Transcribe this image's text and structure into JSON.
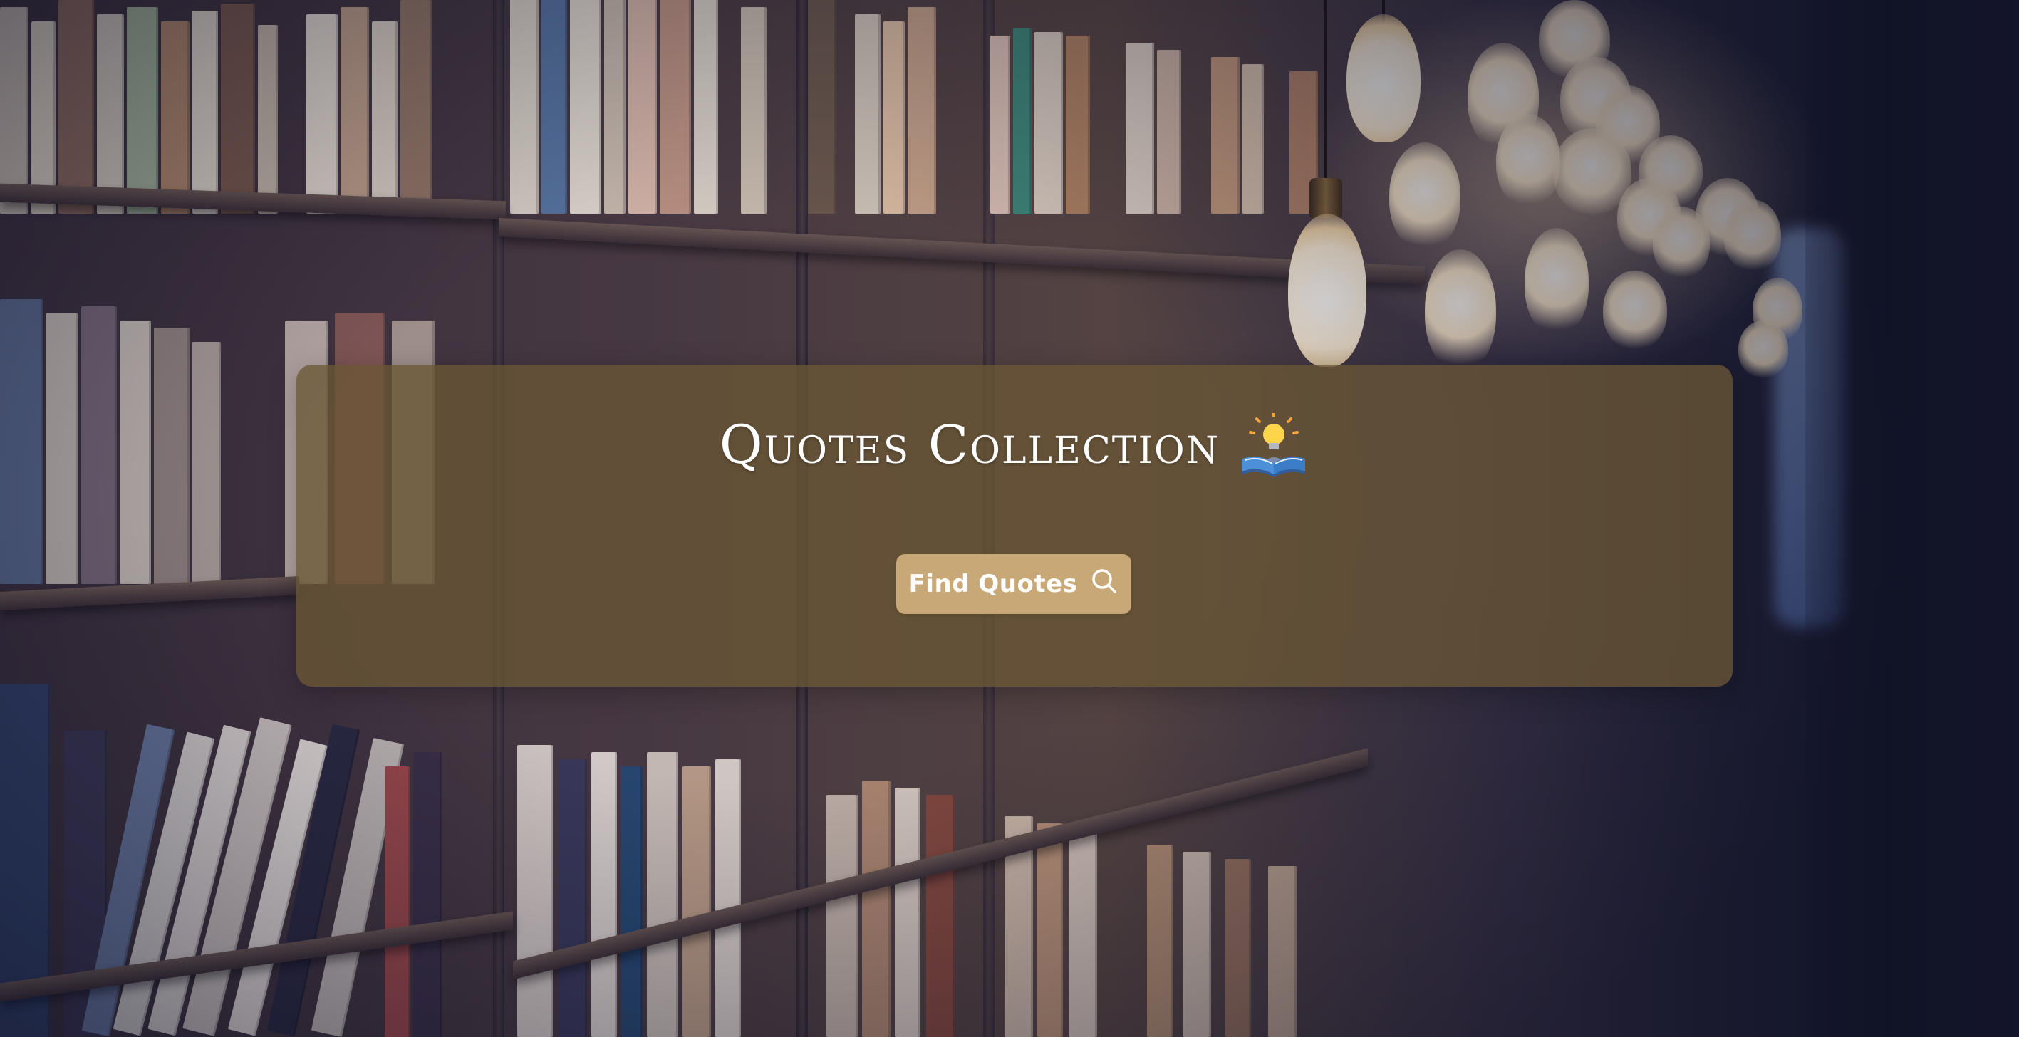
{
  "header": {
    "title": "Quotes Collection",
    "title_icon": "person-reading-book-lightbulb-icon"
  },
  "actions": {
    "find_label": "Find Quotes",
    "find_icon": "search-icon"
  },
  "colors": {
    "panel": "#695634",
    "button": "#c9a878",
    "text": "#ffffff"
  },
  "background": {
    "scene": "library-bookshelves-with-hanging-bulbs"
  }
}
